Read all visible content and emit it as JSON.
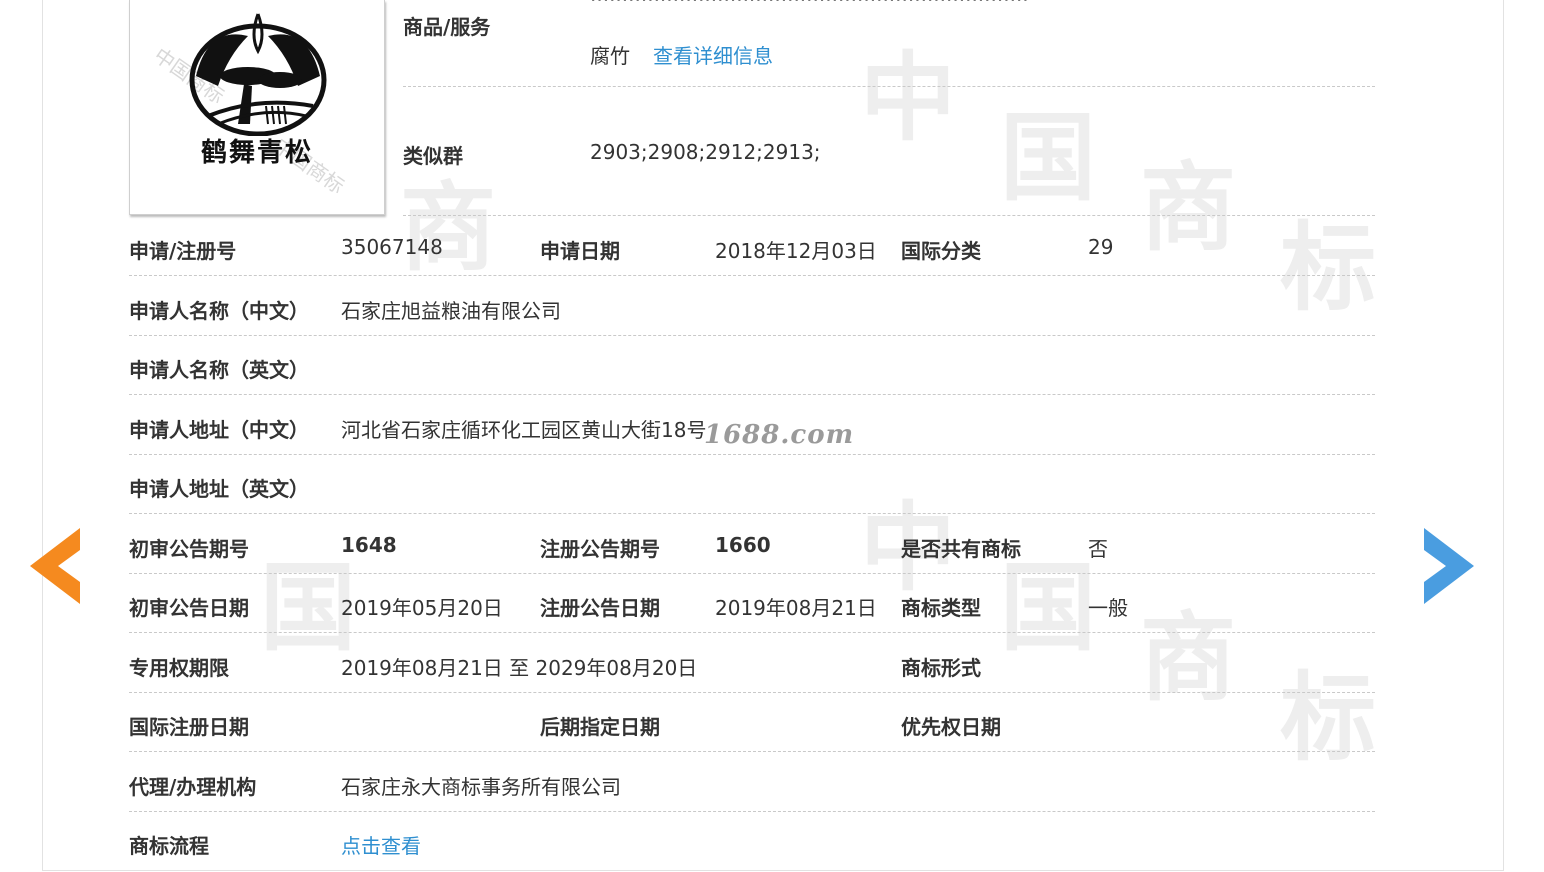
{
  "trademark": {
    "logo_text": "鹤舞青松",
    "stamp_text": "中国商标"
  },
  "goods": {
    "label": "商品/服务",
    "tail_item": "腐竹",
    "detail_link": "查看详细信息"
  },
  "similar_group": {
    "label": "类似群",
    "value": "2903;2908;2912;2913;"
  },
  "rows": {
    "reg_no_label": "申请/注册号",
    "reg_no": "35067148",
    "apply_date_label": "申请日期",
    "apply_date": "2018年12月03日",
    "intl_class_label": "国际分类",
    "intl_class": "29",
    "applicant_cn_label": "申请人名称（中文）",
    "applicant_cn": "石家庄旭益粮油有限公司",
    "applicant_en_label": "申请人名称（英文）",
    "applicant_en": "",
    "address_cn_label": "申请人地址（中文）",
    "address_cn": "河北省石家庄循环化工园区黄山大街18号",
    "address_en_label": "申请人地址（英文）",
    "address_en": "",
    "prelim_no_label": "初审公告期号",
    "prelim_no": "1648",
    "reg_notice_no_label": "注册公告期号",
    "reg_notice_no": "1660",
    "shared_label": "是否共有商标",
    "shared": "否",
    "prelim_date_label": "初审公告日期",
    "prelim_date": "2019年05月20日",
    "reg_notice_date_label": "注册公告日期",
    "reg_notice_date": "2019年08月21日",
    "tm_type_label": "商标类型",
    "tm_type": "一般",
    "term_label": "专用权期限",
    "term": "2019年08月21日 至 2029年08月20日",
    "tm_form_label": "商标形式",
    "tm_form": "",
    "intl_reg_date_label": "国际注册日期",
    "later_date_label": "后期指定日期",
    "priority_date_label": "优先权日期",
    "agent_label": "代理/办理机构",
    "agent": "石家庄永大商标事务所有限公司",
    "process_label": "商标流程",
    "process_link": "点击查看"
  },
  "overlay_watermark": "1688.com",
  "background_watermark": [
    "中",
    "国",
    "商",
    "标"
  ],
  "nav": {
    "prev_color": "#f58a1f",
    "next_color": "#4a9de0"
  }
}
